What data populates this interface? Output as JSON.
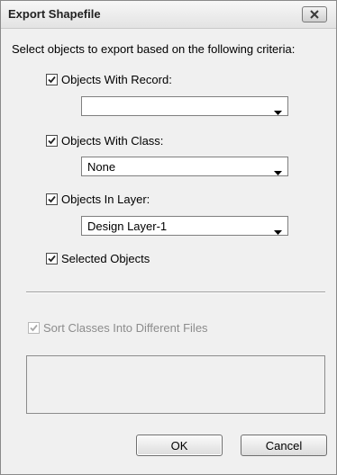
{
  "dialog": {
    "title": "Export Shapefile",
    "instruction": "Select objects to export based on the following criteria:"
  },
  "options": {
    "record": {
      "label": "Objects With Record:",
      "checked": true,
      "value": ""
    },
    "class": {
      "label": "Objects With Class:",
      "checked": true,
      "value": "None"
    },
    "layer": {
      "label": "Objects In Layer:",
      "checked": true,
      "value": "Design Layer-1"
    },
    "selected": {
      "label": "Selected Objects",
      "checked": true
    }
  },
  "sort_classes": {
    "label": "Sort Classes Into Different Files",
    "checked": true,
    "enabled": false
  },
  "buttons": {
    "ok": "OK",
    "cancel": "Cancel"
  },
  "icons": {
    "close": "close-icon",
    "check": "checkmark-icon",
    "dropdown": "chevron-down-icon"
  },
  "colors": {
    "window_bg": "#f0f0f0",
    "disabled_text": "#8c8c8c"
  }
}
